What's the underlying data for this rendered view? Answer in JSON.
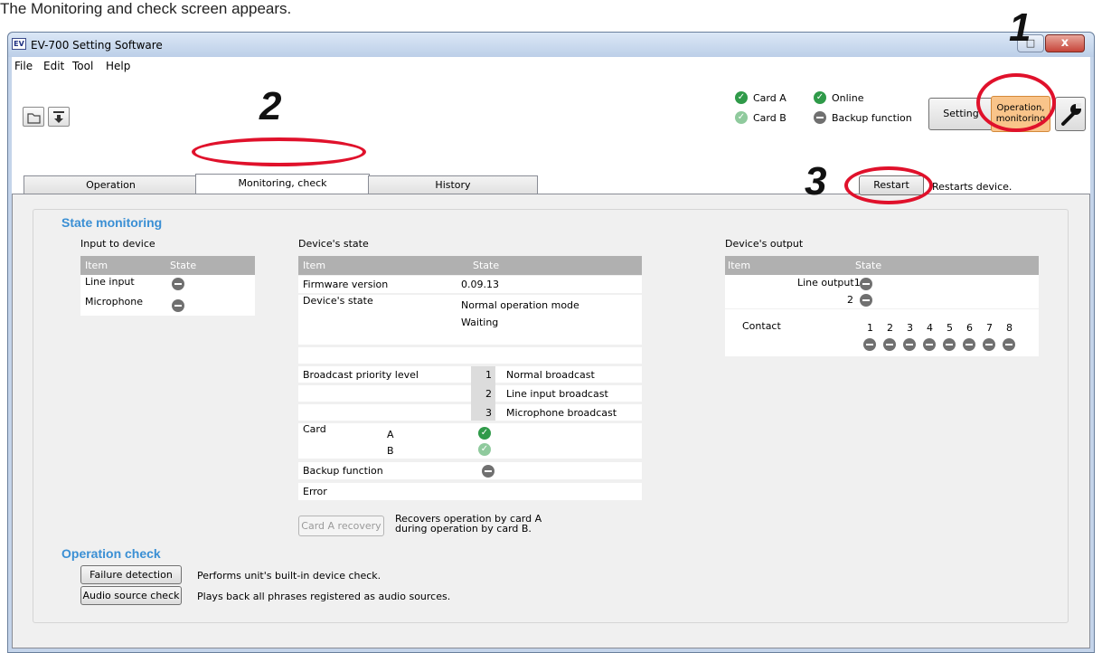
{
  "caption": "The Monitoring and check screen appears.",
  "window": {
    "app_icon": "EV",
    "title": "EV-700 Setting Software",
    "close_glyph": "x",
    "maximize_glyph": "□"
  },
  "menu": [
    "File",
    "Edit",
    "Tool",
    "Help"
  ],
  "status": {
    "card_a": "Card A",
    "card_b": "Card B",
    "online": "Online",
    "backup": "Backup function"
  },
  "mode_buttons": {
    "setting": "Setting",
    "operation": "Operation,\nmonitoring"
  },
  "tabs": [
    "Operation",
    "Monitoring, check",
    "History"
  ],
  "restart": {
    "button": "Restart",
    "description": "Restarts device."
  },
  "state_monitoring": {
    "title": "State monitoring",
    "input": {
      "heading": "Input to device",
      "col_item": "Item",
      "col_state": "State",
      "rows": [
        "Line input",
        "Microphone"
      ]
    },
    "device_state": {
      "heading": "Device's state",
      "col_item": "Item",
      "col_state": "State",
      "firmware_label": "Firmware version",
      "firmware_value": "0.09.13",
      "state_label": "Device's state",
      "state_line1": "Normal operation mode",
      "state_line2": "Waiting",
      "priority_label": "Broadcast priority level",
      "priorities": [
        {
          "num": "1",
          "name": "Normal broadcast"
        },
        {
          "num": "2",
          "name": "Line input broadcast"
        },
        {
          "num": "3",
          "name": "Microphone broadcast"
        }
      ],
      "card_label": "Card",
      "card_a": "A",
      "card_b": "B",
      "backup_label": "Backup function",
      "error_label": "Error"
    },
    "recovery": {
      "button": "Card A recovery",
      "line1": "Recovers operation by card A",
      "line2": "during operation by card B."
    },
    "output": {
      "heading": "Device's output",
      "col_item": "Item",
      "col_state": "State",
      "line_output_1": "Line output1",
      "line_output_2": "2",
      "contact_label": "Contact",
      "contacts": [
        "1",
        "2",
        "3",
        "4",
        "5",
        "6",
        "7",
        "8"
      ]
    }
  },
  "operation_check": {
    "title": "Operation check",
    "failure_button": "Failure detection",
    "failure_desc": "Performs unit's built-in device check.",
    "audio_button": "Audio source check",
    "audio_desc": "Plays back all phrases registered as audio sources."
  },
  "callouts": [
    "1",
    "2",
    "3"
  ],
  "colors": {
    "callout_ring": "#e0112b",
    "heading_blue": "#3a8fd4",
    "active_button": "#f9c48a",
    "status_ok": "#2f9a49"
  }
}
